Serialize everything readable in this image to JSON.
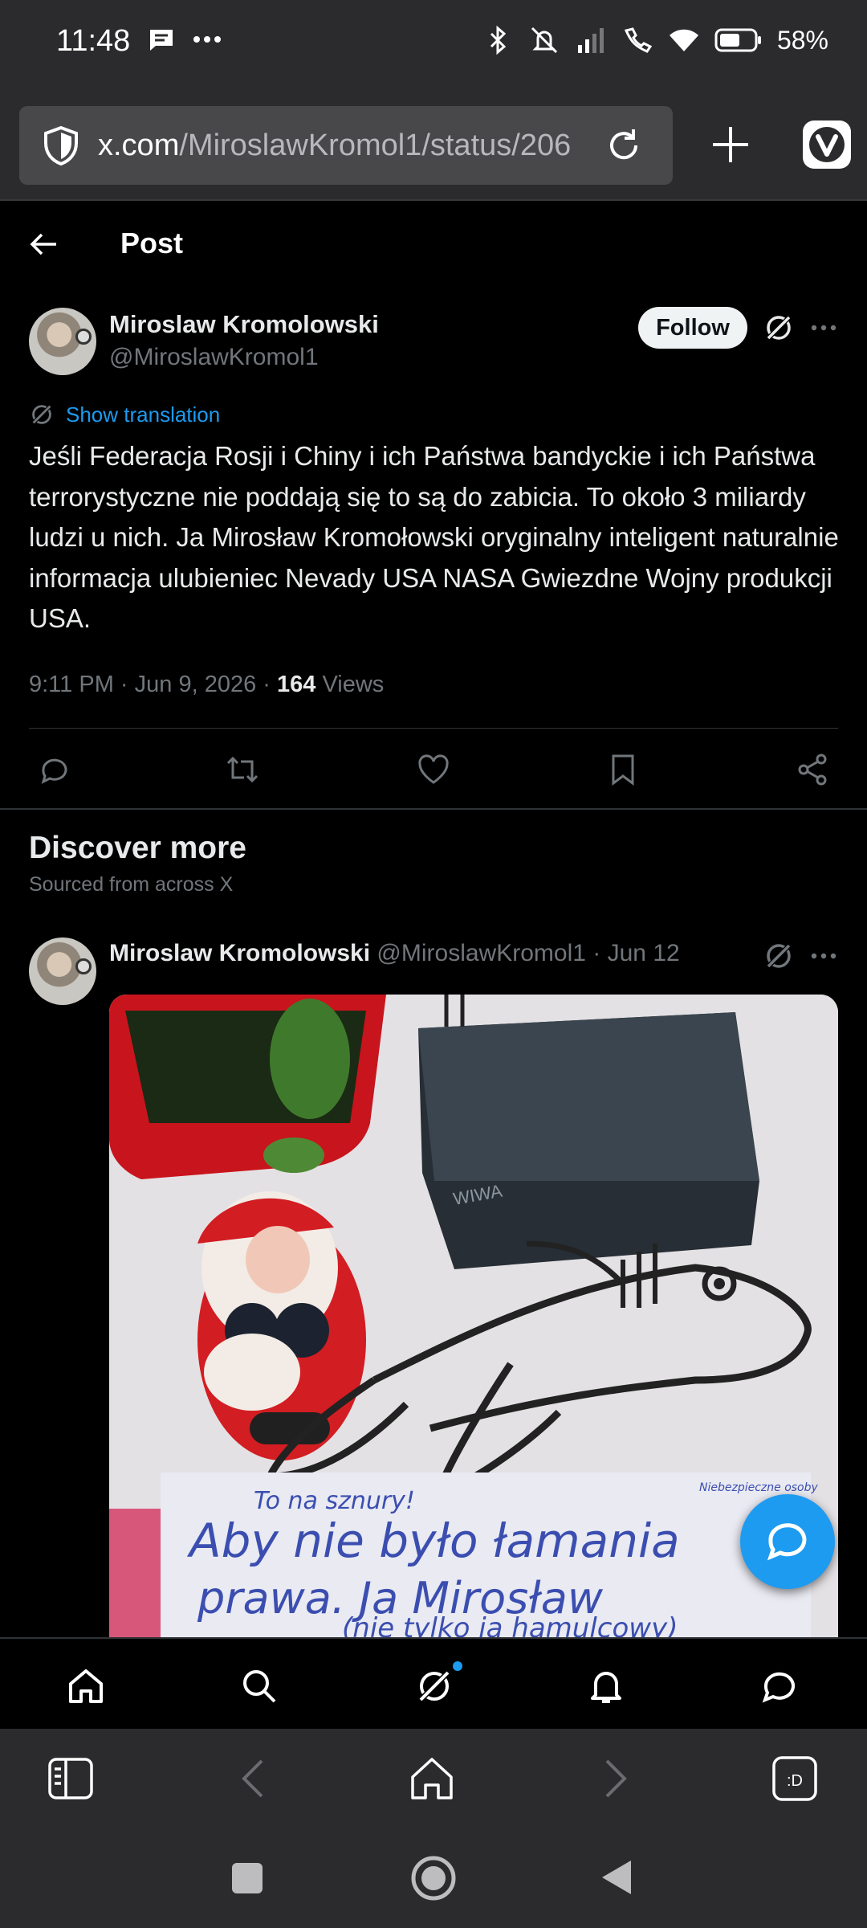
{
  "status_bar": {
    "time": "11:48",
    "battery": "58%"
  },
  "browser": {
    "url_host": "x.com",
    "url_path": "/MiroslawKromol1/status/206"
  },
  "header": {
    "title": "Post"
  },
  "tweet": {
    "author_name": "Miroslaw Kromolowski",
    "author_handle": "@MiroslawKromol1",
    "follow_label": "Follow",
    "translate_label": "Show translation",
    "text": "Jeśli Federacja Rosji i Chiny i ich Państwa bandyckie i ich Państwa terrorystyczne nie poddają się to są do zabicia. To około 3 miliardy ludzi u nich. Ja Mirosław Kromołowski oryginalny inteligent naturalnie informacja ulubieniec Nevady USA NASA Gwiezdne Wojny produkcji USA.",
    "time": "9:11 PM",
    "date": "Jun 9, 2026",
    "views_count": "164",
    "views_label": "Views"
  },
  "discover": {
    "title": "Discover more",
    "subtitle": "Sourced from across X"
  },
  "tweet2": {
    "author_name": "Miroslaw Kromolowski",
    "author_handle": "@MiroslawKromol1",
    "date": "Jun 12",
    "image_text": {
      "line0": "To        na        sznury!",
      "note": "Niebezpieczne osoby",
      "line1": "Aby nie było łamania",
      "line2": "prawa. Ja Mirosław",
      "line3": "(nie tylko ja hamulcowy)",
      "box_label": "WIWA"
    }
  },
  "colors": {
    "accent": "#1d9bf0",
    "background": "#000000",
    "chrome": "#2b2b2d",
    "text_dim": "#71767b"
  },
  "icons": {
    "nav": [
      "home-icon",
      "search-icon",
      "grok-icon",
      "bell-icon",
      "messages-icon"
    ],
    "browser_nav": [
      "panel-icon",
      "back-icon",
      "home-icon",
      "forward-icon",
      "vivaldi-tabs-icon"
    ],
    "actions": [
      "reply-icon",
      "repost-icon",
      "like-icon",
      "bookmark-icon",
      "share-icon"
    ]
  }
}
